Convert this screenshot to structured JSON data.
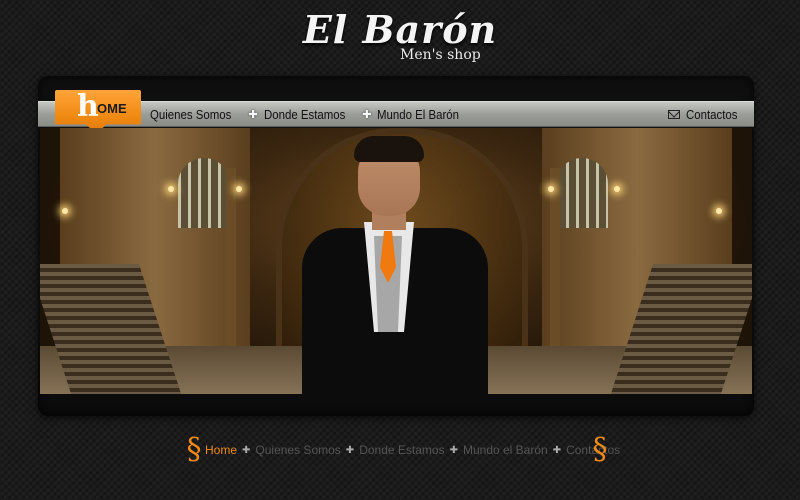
{
  "brand": {
    "title": "El Barón",
    "subtitle": "Men's shop"
  },
  "nav": {
    "home_letter": "h",
    "home_rest": "OME",
    "items": [
      "Quienes Somos",
      "Donde Estamos",
      "Mundo El Barón"
    ],
    "contact": "Contactos"
  },
  "footer_nav": {
    "items": [
      "Home",
      "Quienes Somos",
      "Donde Estamos",
      "Mundo el Barón",
      "Contactos"
    ]
  },
  "colors": {
    "accent": "#f08a12",
    "background": "#1b1b1b",
    "navbar": "#a4a6a1"
  },
  "icons": {
    "nav_separator": "plus-icon",
    "contact": "envelope-icon",
    "footer_ornament": "scroll-ornament-icon"
  }
}
